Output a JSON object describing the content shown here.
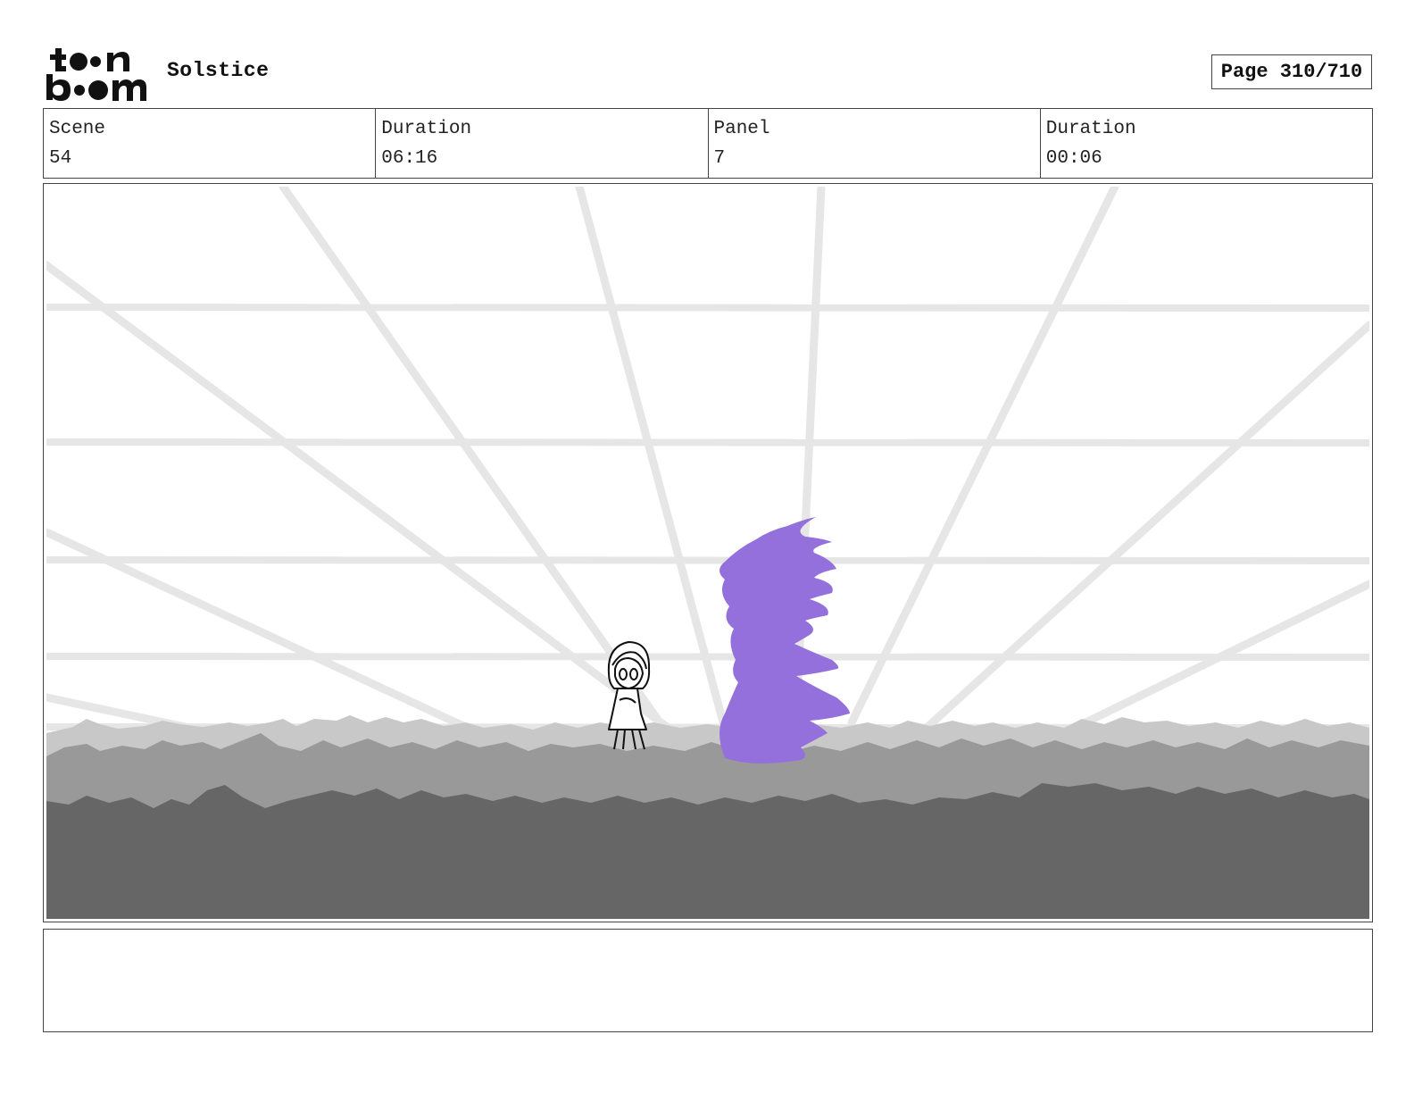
{
  "header": {
    "logo_text": "toon boom",
    "project_title": "Solstice",
    "page_label": "Page 310/710"
  },
  "info": {
    "scene_label": "Scene",
    "scene_value": "54",
    "scene_duration_label": "Duration",
    "scene_duration_value": "06:16",
    "panel_label": "Panel",
    "panel_value": "7",
    "panel_duration_label": "Duration",
    "panel_duration_value": "00:06"
  },
  "panel": {
    "accent_color": "#9370DB",
    "grid_color": "#e6e6e6",
    "ground_light": "#c8c8c8",
    "ground_mid": "#999999",
    "ground_dark": "#666666"
  },
  "notes": {
    "text": ""
  }
}
